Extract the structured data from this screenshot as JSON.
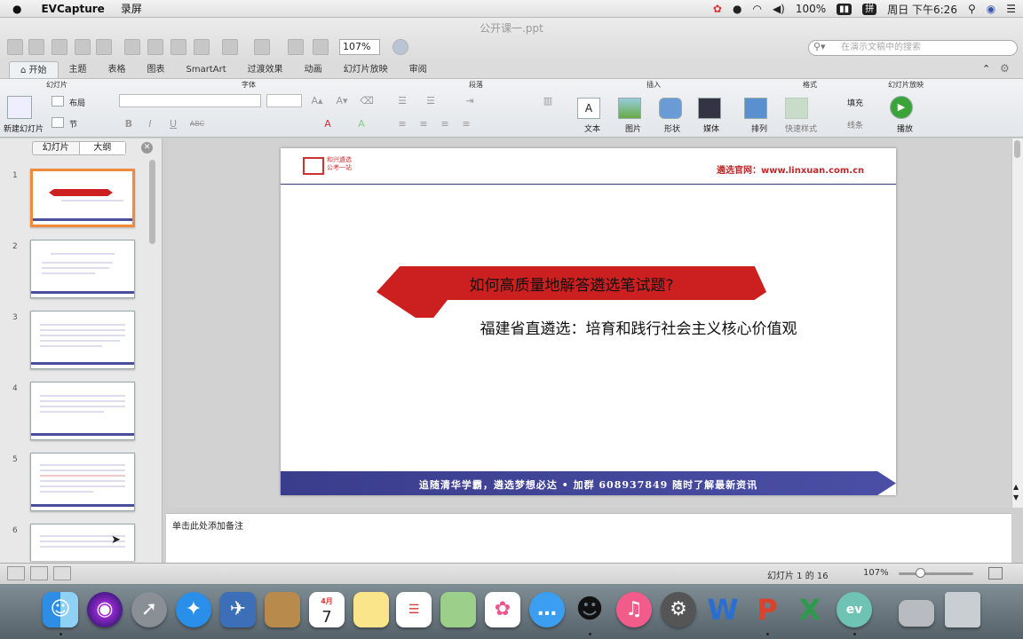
{
  "menubar": {
    "apple": "",
    "app_name": "EVCapture",
    "menu": "录屏",
    "battery": "100%",
    "clock": "周日 下午6:26"
  },
  "window": {
    "title": "公开课一.ppt",
    "zoom": "107%",
    "search_placeholder": "在演示文稿中的搜索"
  },
  "ribbon": {
    "tabs": [
      "开始",
      "主题",
      "表格",
      "图表",
      "SmartArt",
      "过渡效果",
      "动画",
      "幻灯片放映",
      "审阅"
    ],
    "groups": {
      "slides": "幻灯片",
      "font": "字体",
      "paragraph": "段落",
      "insert": "插入",
      "format": "格式",
      "slideshow": "幻灯片放映"
    },
    "new_slide": "新建幻灯片",
    "layout": "布局",
    "section": "节",
    "text": "文本",
    "picture": "图片",
    "shape": "形状",
    "media": "媒体",
    "arrange": "排列",
    "quick_styles": "快速样式",
    "fill": "填充",
    "line": "线条",
    "play": "播放",
    "bold": "B",
    "italic": "I",
    "underline": "U",
    "strike": "ABC"
  },
  "left_panel": {
    "tab_slides": "幻灯片",
    "tab_outline": "大纲",
    "close": "✕",
    "numbers": [
      "1",
      "2",
      "3",
      "4",
      "5",
      "6"
    ]
  },
  "slide": {
    "logo_text_1": "和兴遴选",
    "logo_text_2": "公考一站",
    "website": "遴选官网：www.linxuan.com.cn",
    "question": "如何高质量地解答遴选笔试题?",
    "subtitle": "福建省直遴选：培育和践行社会主义核心价值观",
    "footer": "追随清华学霸，遴选梦想必达  •  加群 608937849 随时了解最新资讯"
  },
  "notes": {
    "placeholder": "单击此处添加备注"
  },
  "status": {
    "slide_count": "幻灯片 1 的 16",
    "zoom": "107%"
  },
  "dock": {
    "calendar_month": "4月",
    "calendar_day": "7"
  },
  "colors": {
    "accent_red": "#cc1f1f",
    "accent_navy": "#3a3d8c",
    "selection": "#f08a3c"
  }
}
